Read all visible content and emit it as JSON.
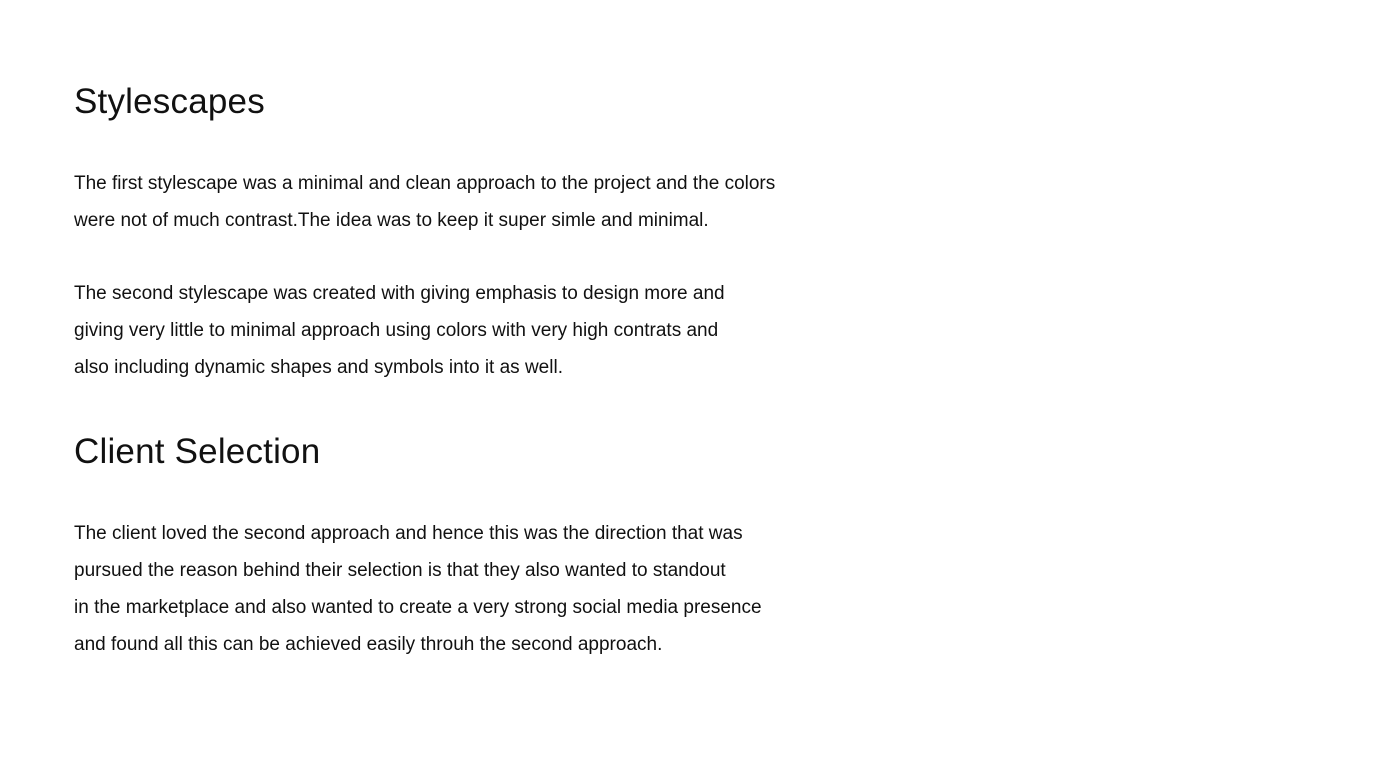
{
  "sections": [
    {
      "heading": "Stylescapes",
      "paragraphs": [
        [
          "The first stylescape was a minimal and clean approach to the project and the colors",
          "were not of much contrast.The idea was to keep it super simle and minimal."
        ],
        [
          "The second stylescape was created with giving emphasis to design more and",
          "giving very little to minimal approach using colors with very high contrats and",
          "also including dynamic shapes and symbols into it as well."
        ]
      ]
    },
    {
      "heading": "Client Selection",
      "paragraphs": [
        [
          "The client loved the second approach and hence this was the direction that was",
          "pursued the reason behind their selection is that they also wanted to standout",
          "in the marketplace and also wanted to create a very strong social media presence",
          "and found all this can be achieved easily throuh the second approach."
        ]
      ]
    }
  ]
}
